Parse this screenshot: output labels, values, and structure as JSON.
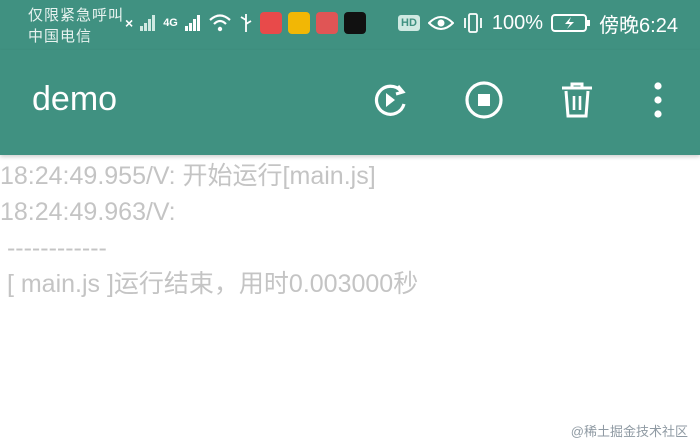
{
  "status_bar": {
    "carrier_line1": "仅限紧急呼叫",
    "carrier_line2": "中国电信",
    "network": "4G",
    "battery": "100%",
    "time": "傍晚6:24",
    "hd_label": "HD",
    "icons": [
      "signal-icon",
      "wifi-icon",
      "usb-icon",
      "app-icon",
      "weibo-icon",
      "book-app-icon",
      "tiktok-icon",
      "hd-icon",
      "eye-icon",
      "vibrate-icon",
      "battery-icon"
    ]
  },
  "toolbar": {
    "title": "demo",
    "color": "#409181",
    "buttons": [
      "rerun-icon",
      "stop-icon",
      "delete-icon",
      "more-icon"
    ]
  },
  "console": {
    "lines": [
      "18:24:49.955/V: 开始运行[main.js]",
      "18:24:49.963/V:",
      " ------------",
      " [ main.js ]运行结束，用时0.003000秒"
    ]
  },
  "watermark": "@稀土掘金技术社区"
}
